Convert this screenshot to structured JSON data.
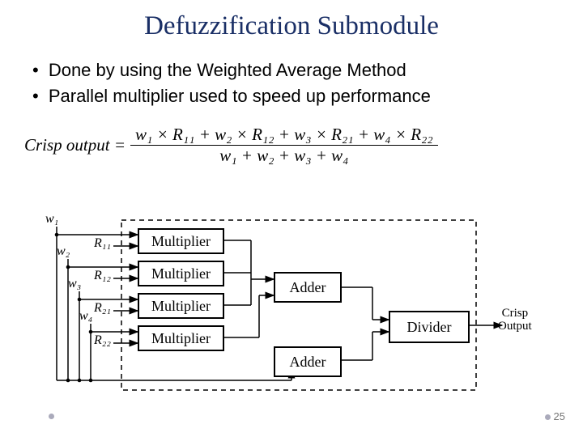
{
  "title": "Defuzzification Submodule",
  "bullets": [
    "Done by using the Weighted Average Method",
    "Parallel multiplier used to speed up performance"
  ],
  "formula": {
    "lhs": "Crisp output =",
    "num": "w₁ × R₁₁ + w₂ × R₁₂ + w₃ × R₂₁ + w₄ × R₂₂",
    "den": "w₁ + w₂ + w₃ + w₄"
  },
  "diagram": {
    "inputs": [
      {
        "w": "w₁",
        "r": "R₁₁"
      },
      {
        "w": "w₂",
        "r": "R₁₂"
      },
      {
        "w": "w₃",
        "r": "R₂₁"
      },
      {
        "w": "w₄",
        "r": "R₂₂"
      }
    ],
    "blocks": {
      "multiplier": "Multiplier",
      "adder": "Adder",
      "divider": "Divider"
    },
    "output": "Crisp\nOutput"
  },
  "page": "25"
}
